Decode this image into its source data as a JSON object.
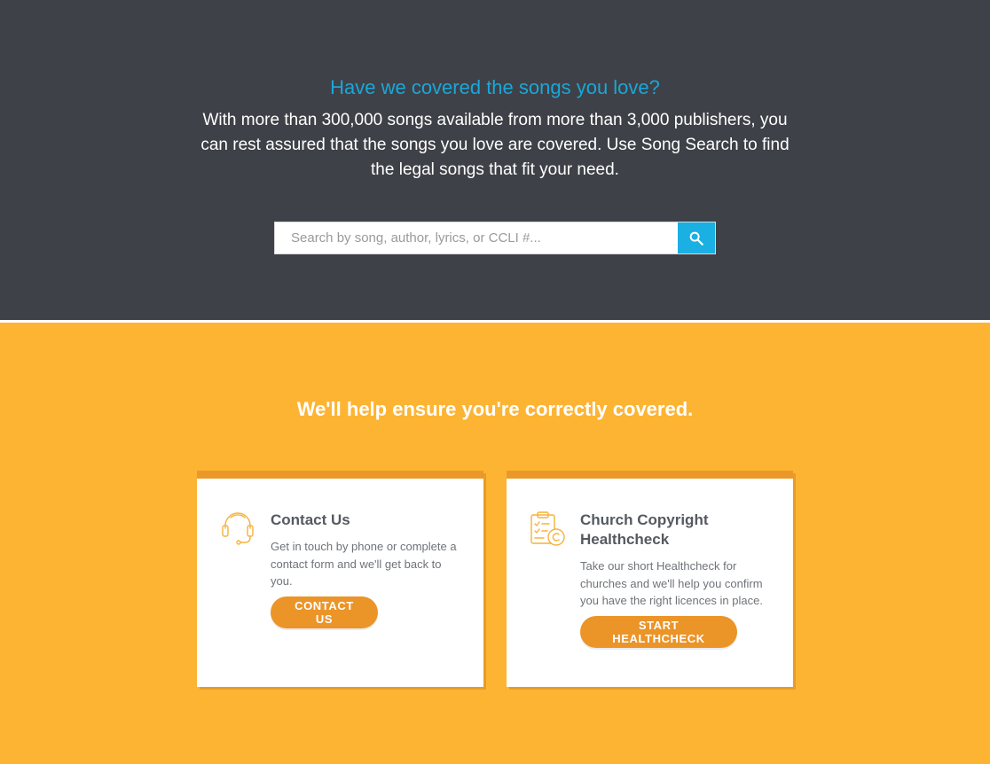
{
  "hero": {
    "title": "Have we covered the songs you love?",
    "text": "With more than 300,000 songs available from more than 3,000 publishers, you can rest assured that the songs you love are covered. Use Song Search to find the legal songs that fit your need.",
    "search": {
      "placeholder": "Search by song, author, lyrics, or CCLI #...",
      "value": "",
      "button_icon": "search-icon"
    }
  },
  "help": {
    "title": "We'll help ensure you're correctly covered.",
    "cards": [
      {
        "icon": "headset-icon",
        "title": "Contact Us",
        "description": "Get in touch by phone or complete a contact form and we'll get back to you.",
        "button_label": "CONTACT US"
      },
      {
        "icon": "clipboard-copyright-icon",
        "title": "Church Copyright Healthcheck",
        "description": "Take our short Healthcheck for churches and we'll help you confirm you have the right licences in place.",
        "button_label": "START HEALTHCHECK"
      }
    ]
  },
  "colors": {
    "hero_bg": "#3f4148",
    "accent_blue": "#1ab0e3",
    "section_bg": "#fdb433",
    "button_orange": "#eb9428"
  }
}
